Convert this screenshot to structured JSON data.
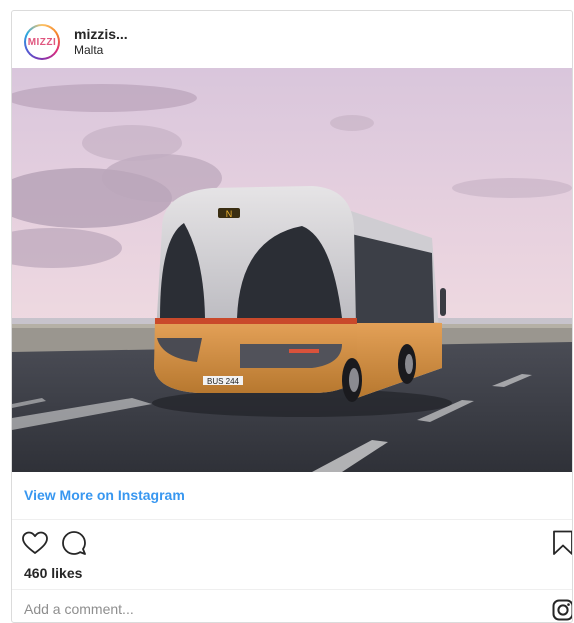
{
  "post": {
    "username": "mizzis...",
    "location": "Malta",
    "avatar_text": "MIZZI",
    "view_more_label": "View More on Instagram",
    "likes_label": "460 likes",
    "comment_placeholder": "Add a comment...",
    "bus_plate": "BUS 244",
    "bus_sign": "N"
  },
  "icons": {
    "like": "heart-icon",
    "comment": "comment-icon",
    "save": "bookmark-icon",
    "instagram": "instagram-icon"
  },
  "colors": {
    "link": "#3897f0",
    "text": "#262626",
    "muted": "#8e8e8e",
    "border": "#dbdbdb"
  }
}
